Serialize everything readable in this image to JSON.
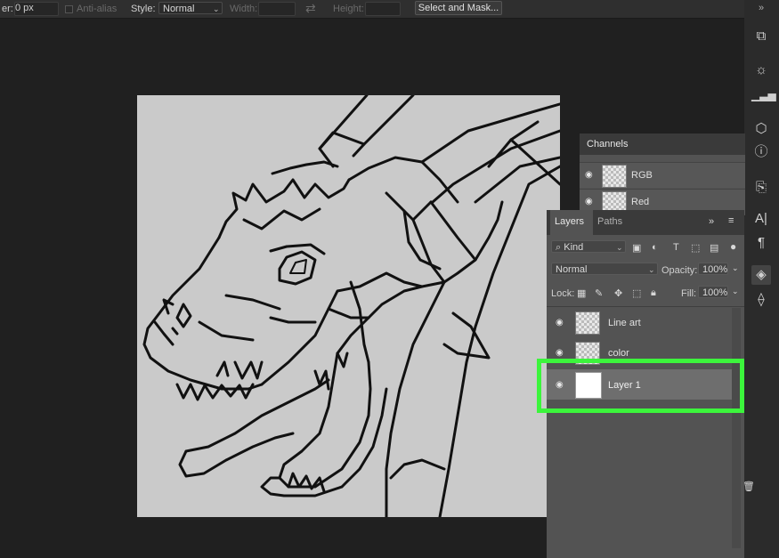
{
  "options_bar": {
    "feather_label": "er:",
    "feather_value": "0 px",
    "anti_alias_label": "Anti-alias",
    "style_label": "Style:",
    "style_value": "Normal",
    "width_label": "Width:",
    "height_label": "Height:",
    "select_mask_label": "Select and Mask...",
    "swap_icon": "⇄"
  },
  "channels_panel": {
    "tab": "Channels",
    "rows": [
      {
        "name": "RGB"
      },
      {
        "name": "Red"
      }
    ]
  },
  "layers_panel": {
    "tabs": [
      "Layers",
      "Paths"
    ],
    "filter_kind": "Kind",
    "blend_mode": "Normal",
    "opacity_label": "Opacity:",
    "opacity_value": "100%",
    "lock_label": "Lock:",
    "fill_label": "Fill:",
    "fill_value": "100%",
    "layers": [
      {
        "name": "Line art",
        "selected": false
      },
      {
        "name": "color",
        "selected": false
      },
      {
        "name": "Layer 1",
        "selected": true
      }
    ]
  },
  "highlight_color": "#3cf53c",
  "right_tools": [
    "history-icon",
    "adjustments-icon",
    "histogram-icon",
    "3d-icon",
    "info-icon",
    "clone-source-icon",
    "character-icon",
    "paragraph-icon",
    "layers-icon",
    "paths-icon"
  ]
}
